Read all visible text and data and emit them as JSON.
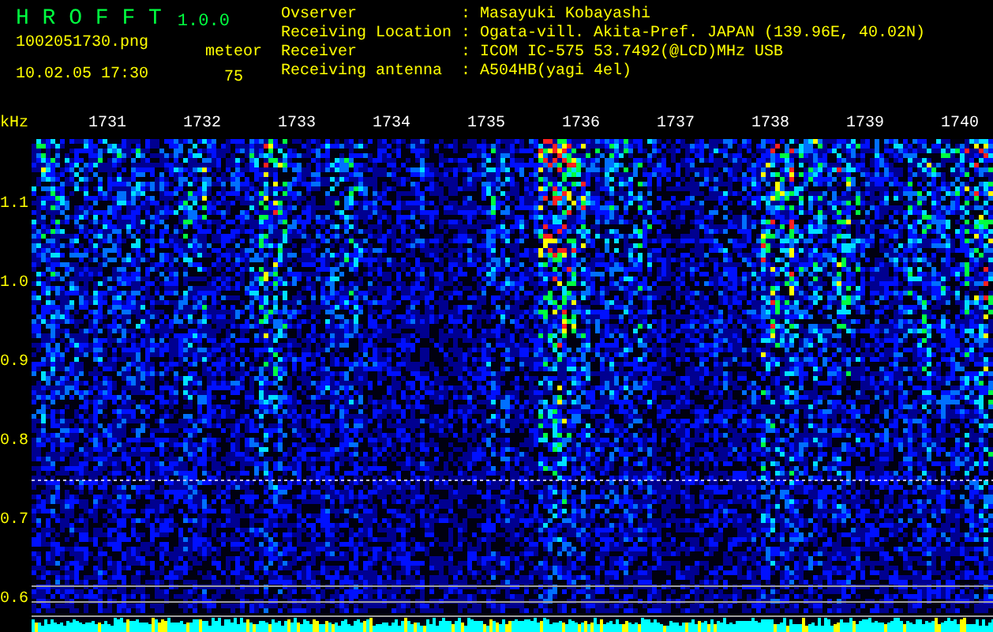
{
  "app": {
    "title": "H R O F F T",
    "version": "1.0.0"
  },
  "file": {
    "name": "1002051730.png",
    "datetime": "10.02.05 17:30"
  },
  "counter": {
    "label": "meteor",
    "value": "75"
  },
  "info": [
    {
      "label": "Ovserver",
      "separator": ":",
      "value": "Masayuki Kobayashi"
    },
    {
      "label": "Receiving Location",
      "separator": ":",
      "value": "Ogata-vill. Akita-Pref. JAPAN (139.96E, 40.02N)"
    },
    {
      "label": "Receiver",
      "separator": ":",
      "value": "ICOM IC-575 53.7492(@LCD)MHz USB"
    },
    {
      "label": "Receiving antenna",
      "separator": ":",
      "value": "A504HB(yagi 4el)"
    }
  ],
  "spectrogram": {
    "unit": "kHz",
    "y_labels": [
      "1.1",
      "1.0",
      "0.9",
      "0.8",
      "0.7",
      "0.6"
    ],
    "time_labels": [
      "1731",
      "1732",
      "1733",
      "1734",
      "1735",
      "1736",
      "1737",
      "1738",
      "1739",
      "1740"
    ]
  }
}
